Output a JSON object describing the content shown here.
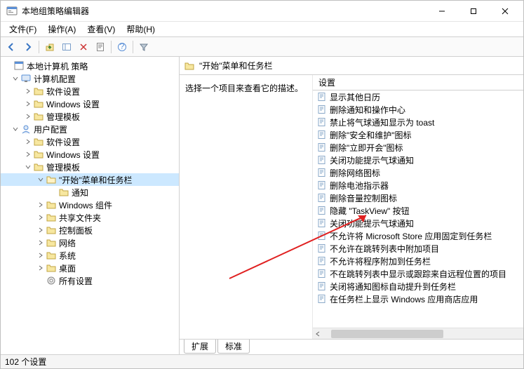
{
  "window": {
    "title": "本地组策略编辑器"
  },
  "menu": {
    "file": "文件(F)",
    "action": "操作(A)",
    "view": "查看(V)",
    "help": "帮助(H)"
  },
  "tree": {
    "root": "本地计算机 策略",
    "computer": "计算机配置",
    "comp_software": "软件设置",
    "comp_windows": "Windows 设置",
    "comp_admin": "管理模板",
    "user": "用户配置",
    "user_software": "软件设置",
    "user_windows": "Windows 设置",
    "user_admin": "管理模板",
    "start_taskbar": "\"开始\"菜单和任务栏",
    "notify": "通知",
    "win_components": "Windows 组件",
    "shared_folders": "共享文件夹",
    "control_panel": "控制面板",
    "network": "网络",
    "system": "系统",
    "desktop": "桌面",
    "all_settings": "所有设置"
  },
  "header": {
    "title": "\"开始\"菜单和任务栏"
  },
  "desc": {
    "text": "选择一个项目来查看它的描述。"
  },
  "list": {
    "column": "设置",
    "items": [
      "显示其他日历",
      "删除通知和操作中心",
      "禁止将气球通知显示为 toast",
      "删除\"安全和维护\"图标",
      "删除\"立即开会\"图标",
      "关闭功能提示气球通知",
      "删除网络图标",
      "删除电池指示器",
      "删除音量控制图标",
      "隐藏 \"TaskView\" 按钮",
      "关闭功能提示气球通知",
      "不允许将 Microsoft Store 应用固定到任务栏",
      "不允许在跳转列表中附加项目",
      "不允许将程序附加到任务栏",
      "不在跳转列表中显示或跟踪来自远程位置的项目",
      "关闭将通知图标自动提升到任务栏",
      "在任务栏上显示 Windows 应用商店应用"
    ]
  },
  "tabs": {
    "extended": "扩展",
    "standard": "标准"
  },
  "status": {
    "text": "102 个设置"
  }
}
